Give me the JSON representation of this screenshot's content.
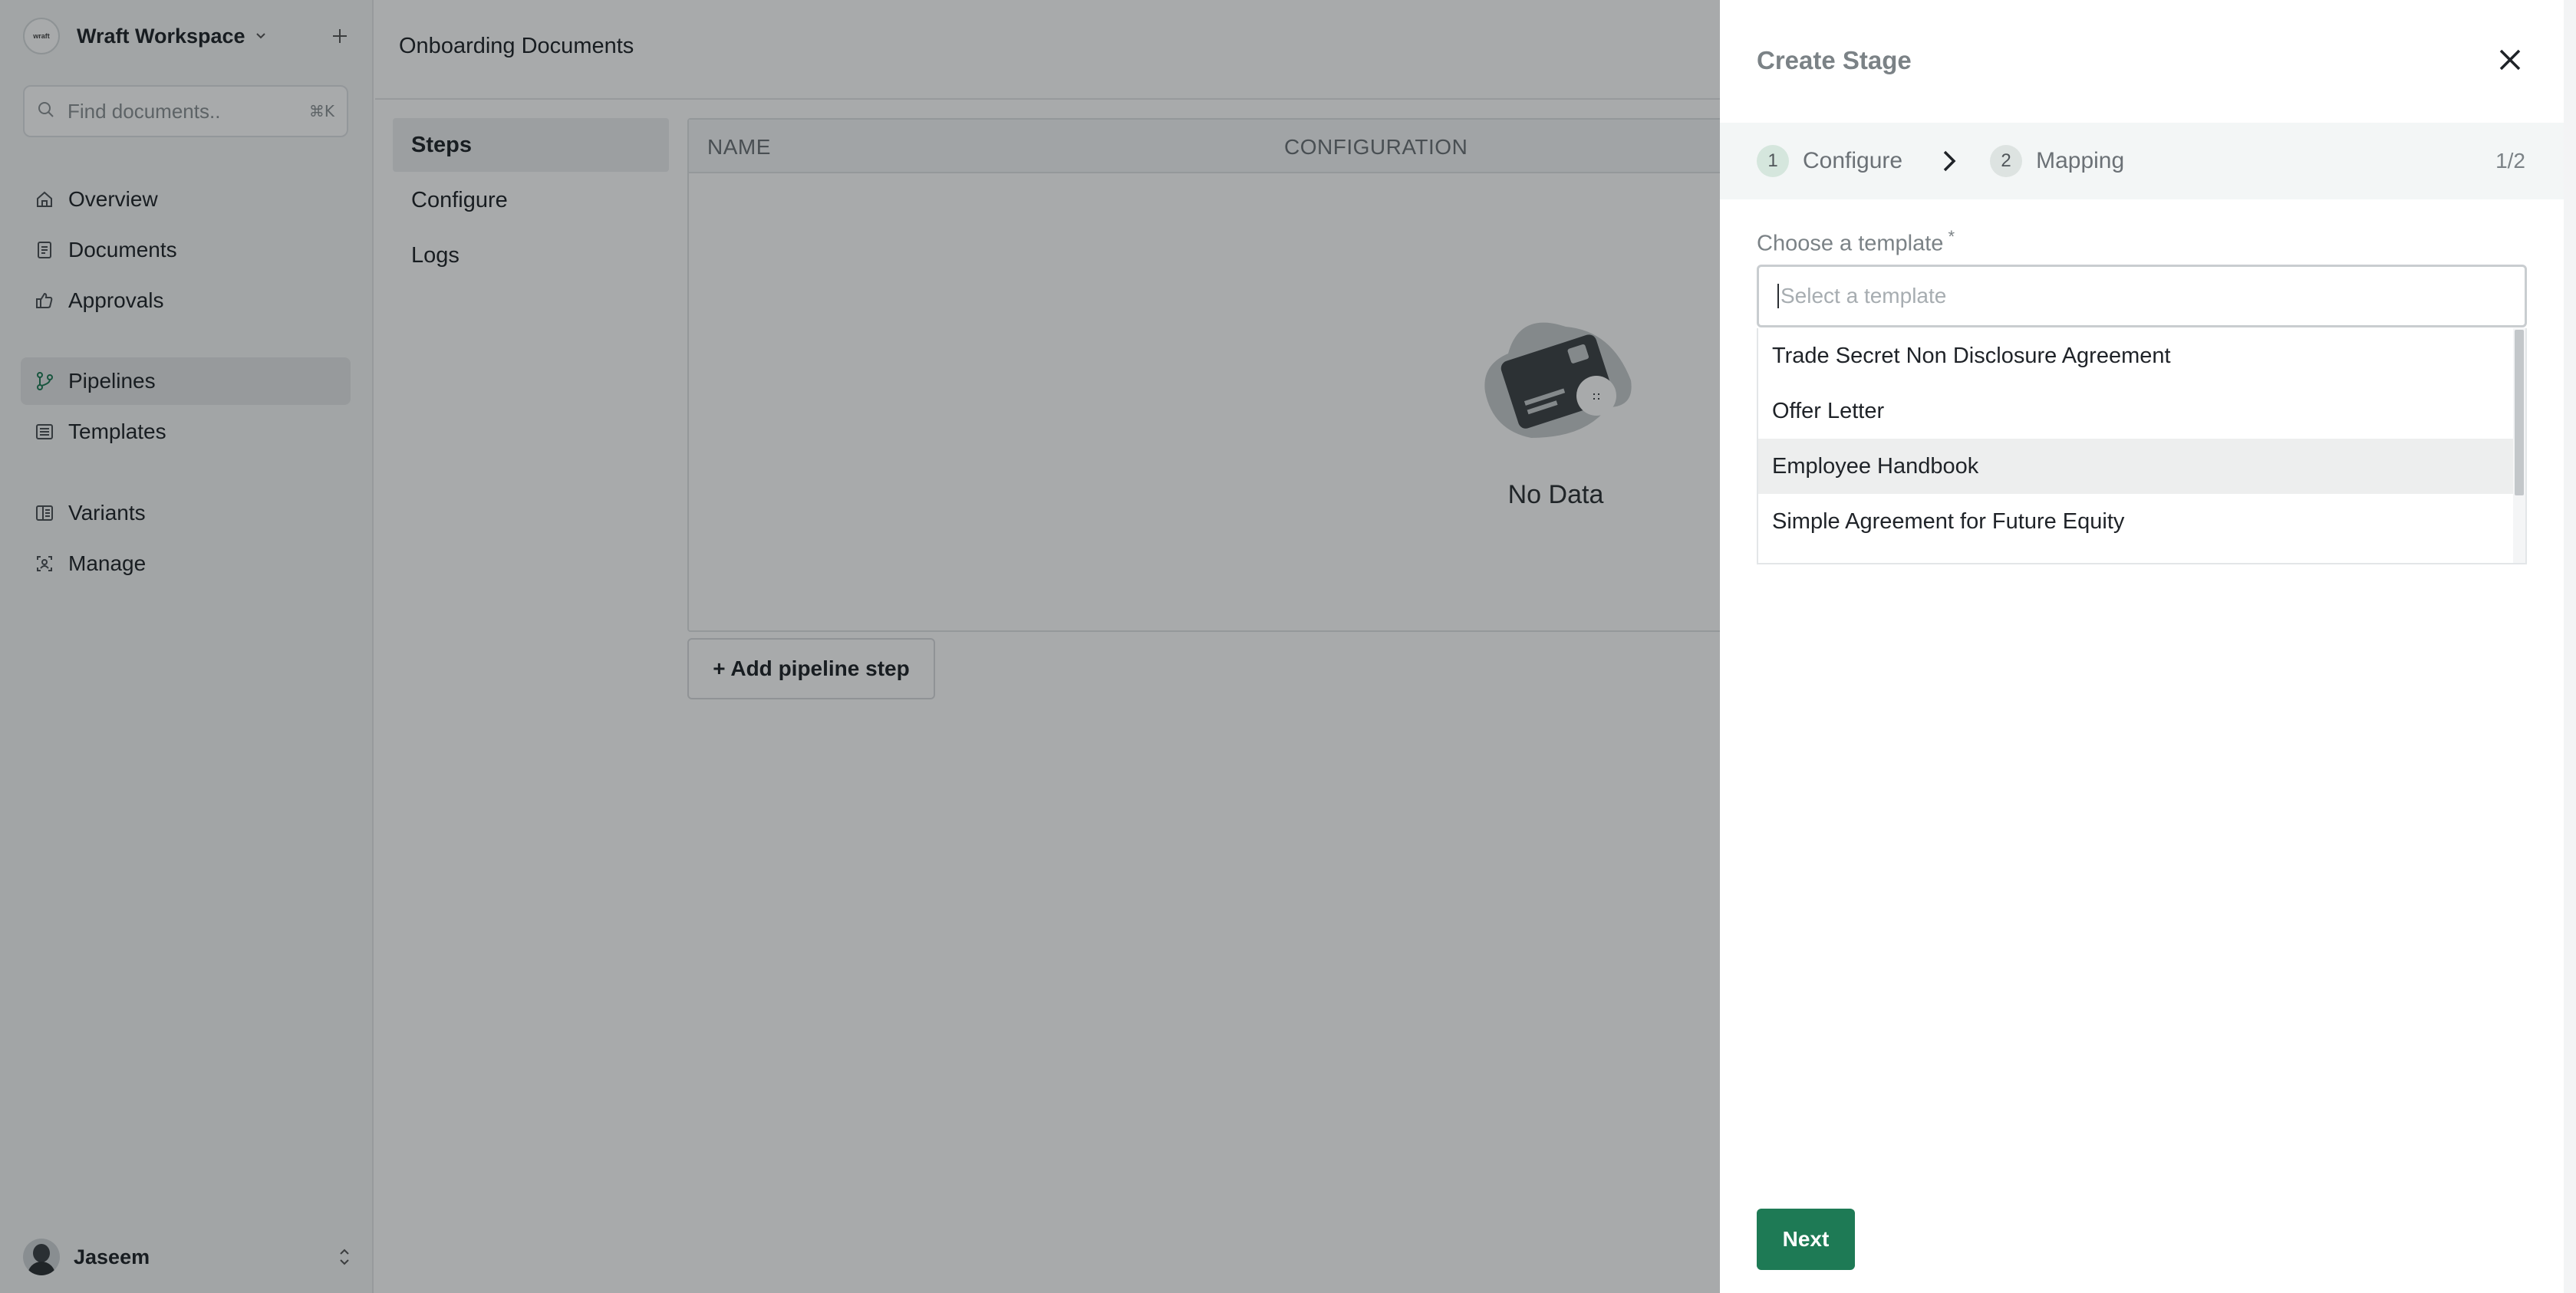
{
  "workspace": {
    "name": "Wraft Workspace"
  },
  "search": {
    "placeholder": "Find documents..",
    "shortcut": "⌘K"
  },
  "sidebar": {
    "items": [
      {
        "label": "Overview",
        "icon": "home-icon"
      },
      {
        "label": "Documents",
        "icon": "document-icon"
      },
      {
        "label": "Approvals",
        "icon": "thumbs-up-icon"
      },
      {
        "label": "Pipelines",
        "icon": "pipeline-branch-icon",
        "active": true
      },
      {
        "label": "Templates",
        "icon": "template-icon"
      },
      {
        "label": "Variants",
        "icon": "variants-icon"
      },
      {
        "label": "Manage",
        "icon": "manage-icon"
      }
    ]
  },
  "user": {
    "name": "Jaseem"
  },
  "main": {
    "title": "Onboarding Documents",
    "tabs": [
      {
        "label": "Steps",
        "active": true
      },
      {
        "label": "Configure"
      },
      {
        "label": "Logs"
      }
    ],
    "table": {
      "columns": [
        "NAME",
        "CONFIGURATION"
      ],
      "empty_text": "No Data"
    },
    "add_step_label": "+ Add pipeline step"
  },
  "drawer": {
    "title": "Create Stage",
    "steps": [
      {
        "num": "1",
        "label": "Configure",
        "active": true
      },
      {
        "num": "2",
        "label": "Mapping"
      }
    ],
    "step_count": "1/2",
    "field_label": "Choose a template",
    "required_mark": "*",
    "select_placeholder": "Select a template",
    "options": [
      "Trade Secret Non Disclosure Agreement",
      "Offer Letter",
      "Employee Handbook",
      "Simple Agreement for Future Equity"
    ],
    "hovered_option": "Employee Handbook",
    "next_label": "Next"
  },
  "colors": {
    "primary_button": "#1e7a55",
    "overlay": "rgba(15,20,22,0.36)"
  }
}
